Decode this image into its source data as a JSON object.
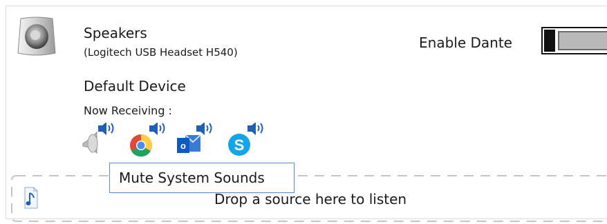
{
  "device": {
    "name": "Speakers",
    "subtitle": "(Logitech USB Headset H540)",
    "icon": "speaker-device-icon"
  },
  "dante": {
    "label": "Enable Dante",
    "enabled": false
  },
  "status": {
    "default_label": "Default Device",
    "receiving_label": "Now Receiving :"
  },
  "sources": [
    {
      "name": "System Sounds",
      "icon": "system-sounds-icon"
    },
    {
      "name": "Chrome",
      "icon": "chrome-icon"
    },
    {
      "name": "Outlook",
      "icon": "outlook-icon"
    },
    {
      "name": "Skype",
      "icon": "skype-icon"
    }
  ],
  "tooltip": {
    "text": "Mute System Sounds"
  },
  "dropzone": {
    "text": "Drop a source here to listen",
    "icon": "music-note-icon"
  },
  "colors": {
    "accent": "#1f5fb4",
    "tooltip_border": "#5a8fd3",
    "toggle_track": "#b9b9b9"
  }
}
